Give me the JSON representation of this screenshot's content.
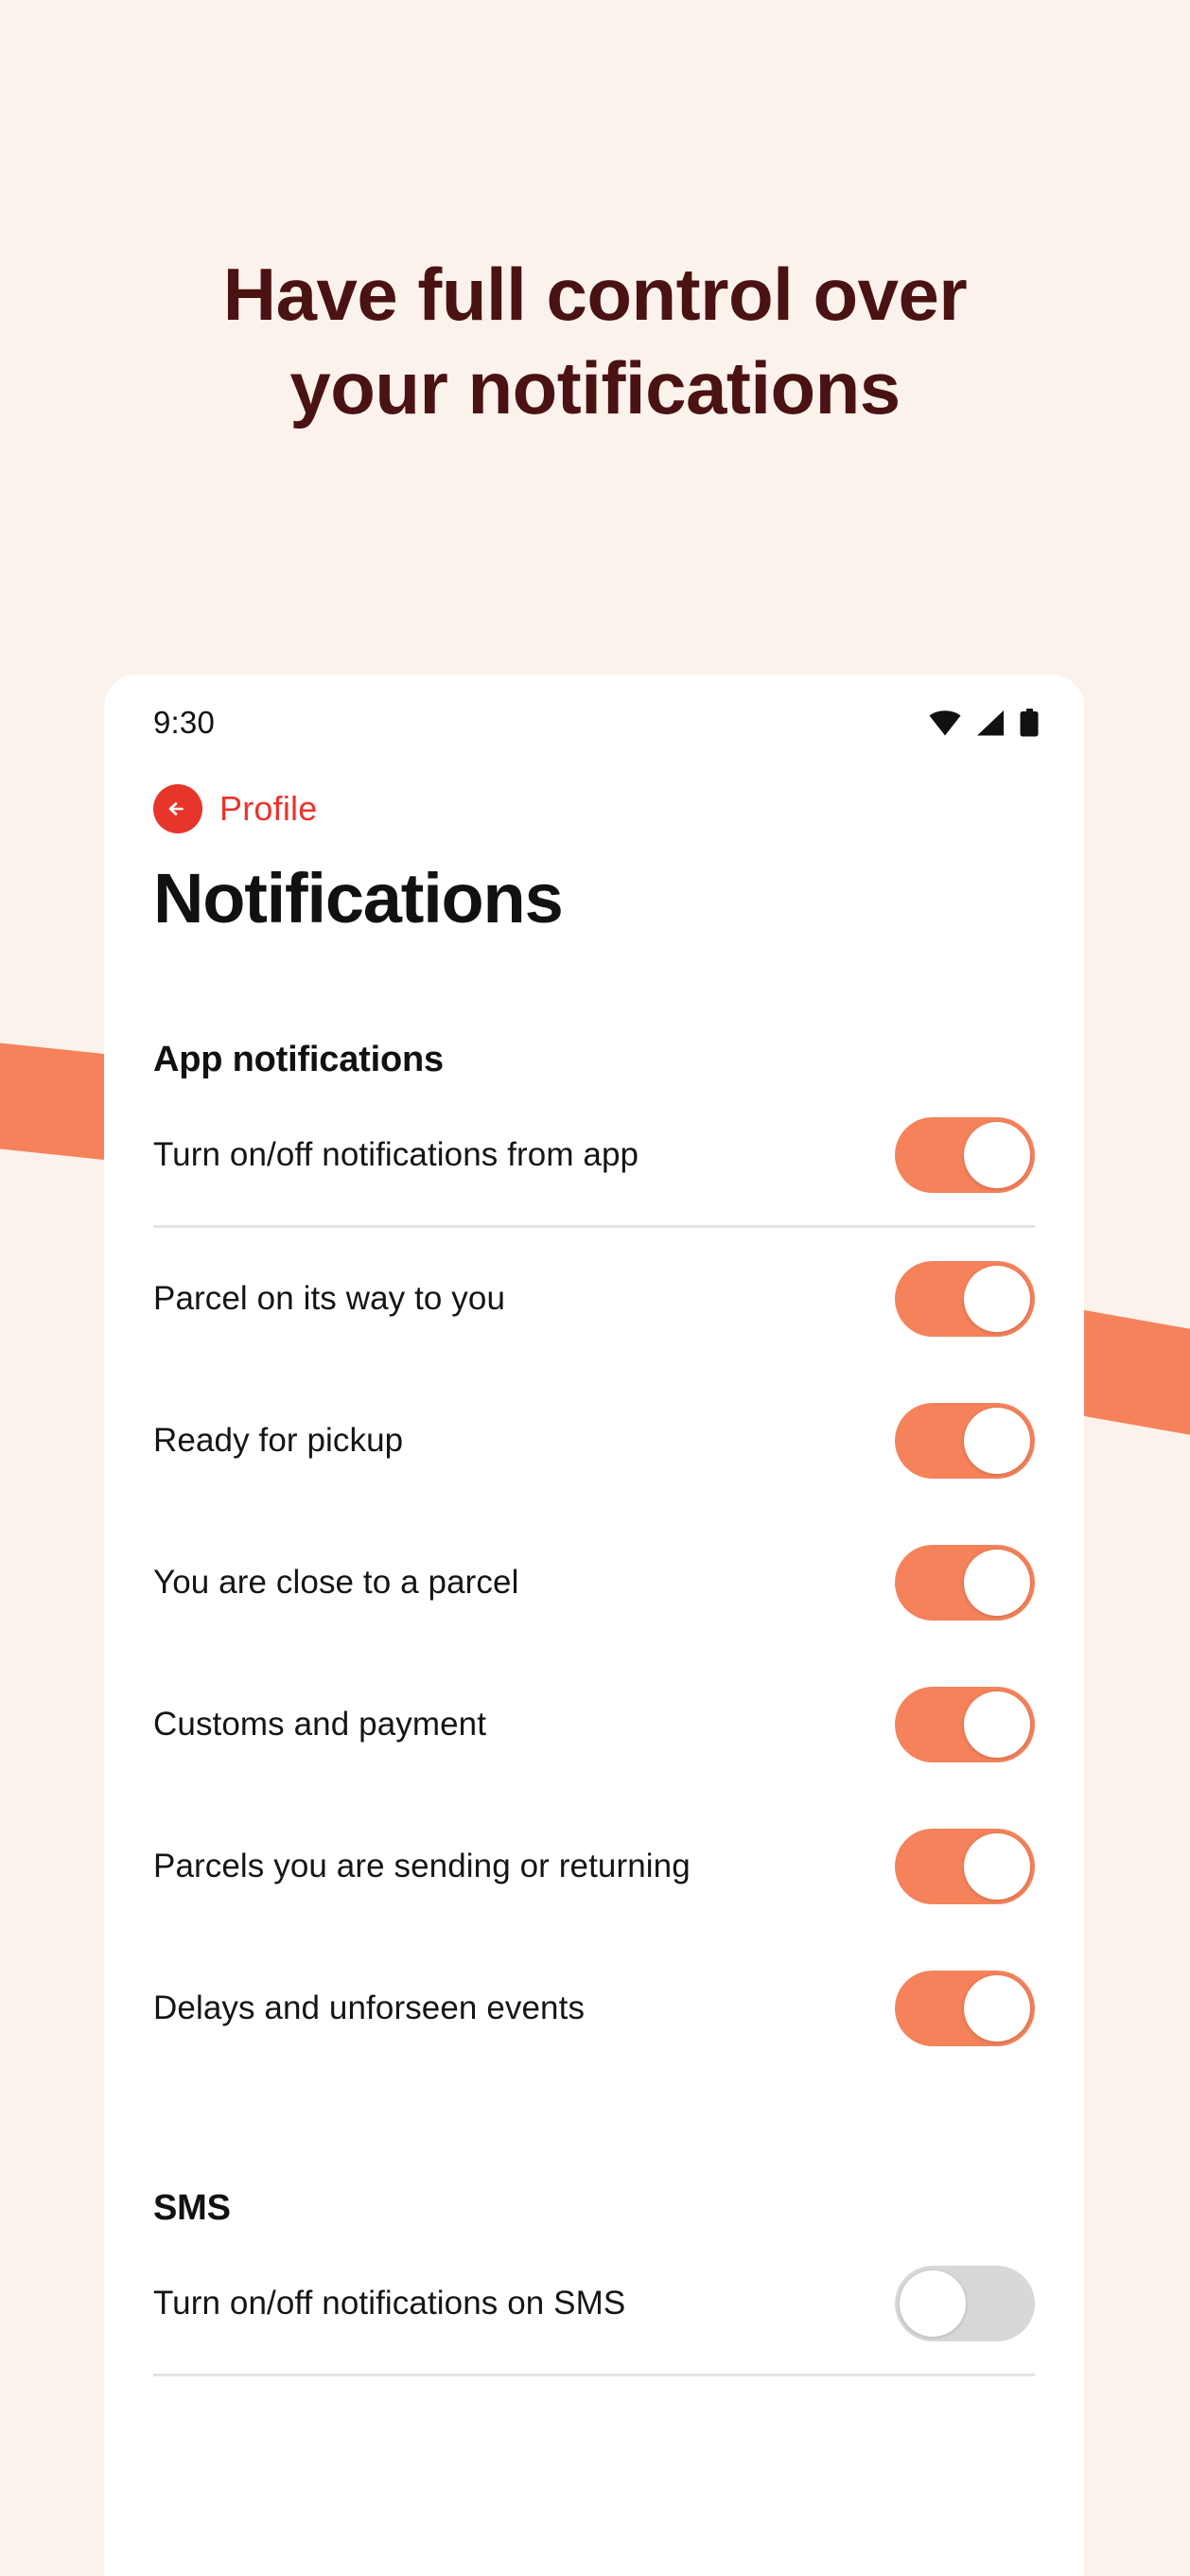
{
  "theme": {
    "page_background": "#FCF2EC",
    "heading_color": "#4A1212",
    "accent_orange": "#F5825A",
    "accent_red": "#E8352B",
    "toggle_off": "#D8D8D8"
  },
  "hero": {
    "line1": "Have full control over",
    "line2": "your notifications"
  },
  "phone": {
    "statusbar": {
      "time": "9:30",
      "icons": [
        "wifi-icon",
        "cellular-signal-icon",
        "battery-icon"
      ]
    },
    "nav": {
      "back_icon": "arrow-left-icon",
      "back_label": "Profile"
    },
    "title": "Notifications",
    "sections": [
      {
        "id": "app-notifications",
        "title": "App notifications",
        "rows": [
          {
            "label": "Turn on/off notifications from app",
            "state": "on",
            "divider": true
          },
          {
            "label": "Parcel on its way to you",
            "state": "on",
            "divider": false
          },
          {
            "label": "Ready for pickup",
            "state": "on",
            "divider": false
          },
          {
            "label": "You are close to a parcel",
            "state": "on",
            "divider": false
          },
          {
            "label": "Customs and payment",
            "state": "on",
            "divider": false
          },
          {
            "label": "Parcels you are sending or returning",
            "state": "on",
            "divider": false
          },
          {
            "label": "Delays and unforseen events",
            "state": "on",
            "divider": false
          }
        ]
      },
      {
        "id": "sms",
        "title": "SMS",
        "rows": [
          {
            "label": "Turn on/off notifications on SMS",
            "state": "off",
            "divider": true
          }
        ]
      }
    ]
  }
}
